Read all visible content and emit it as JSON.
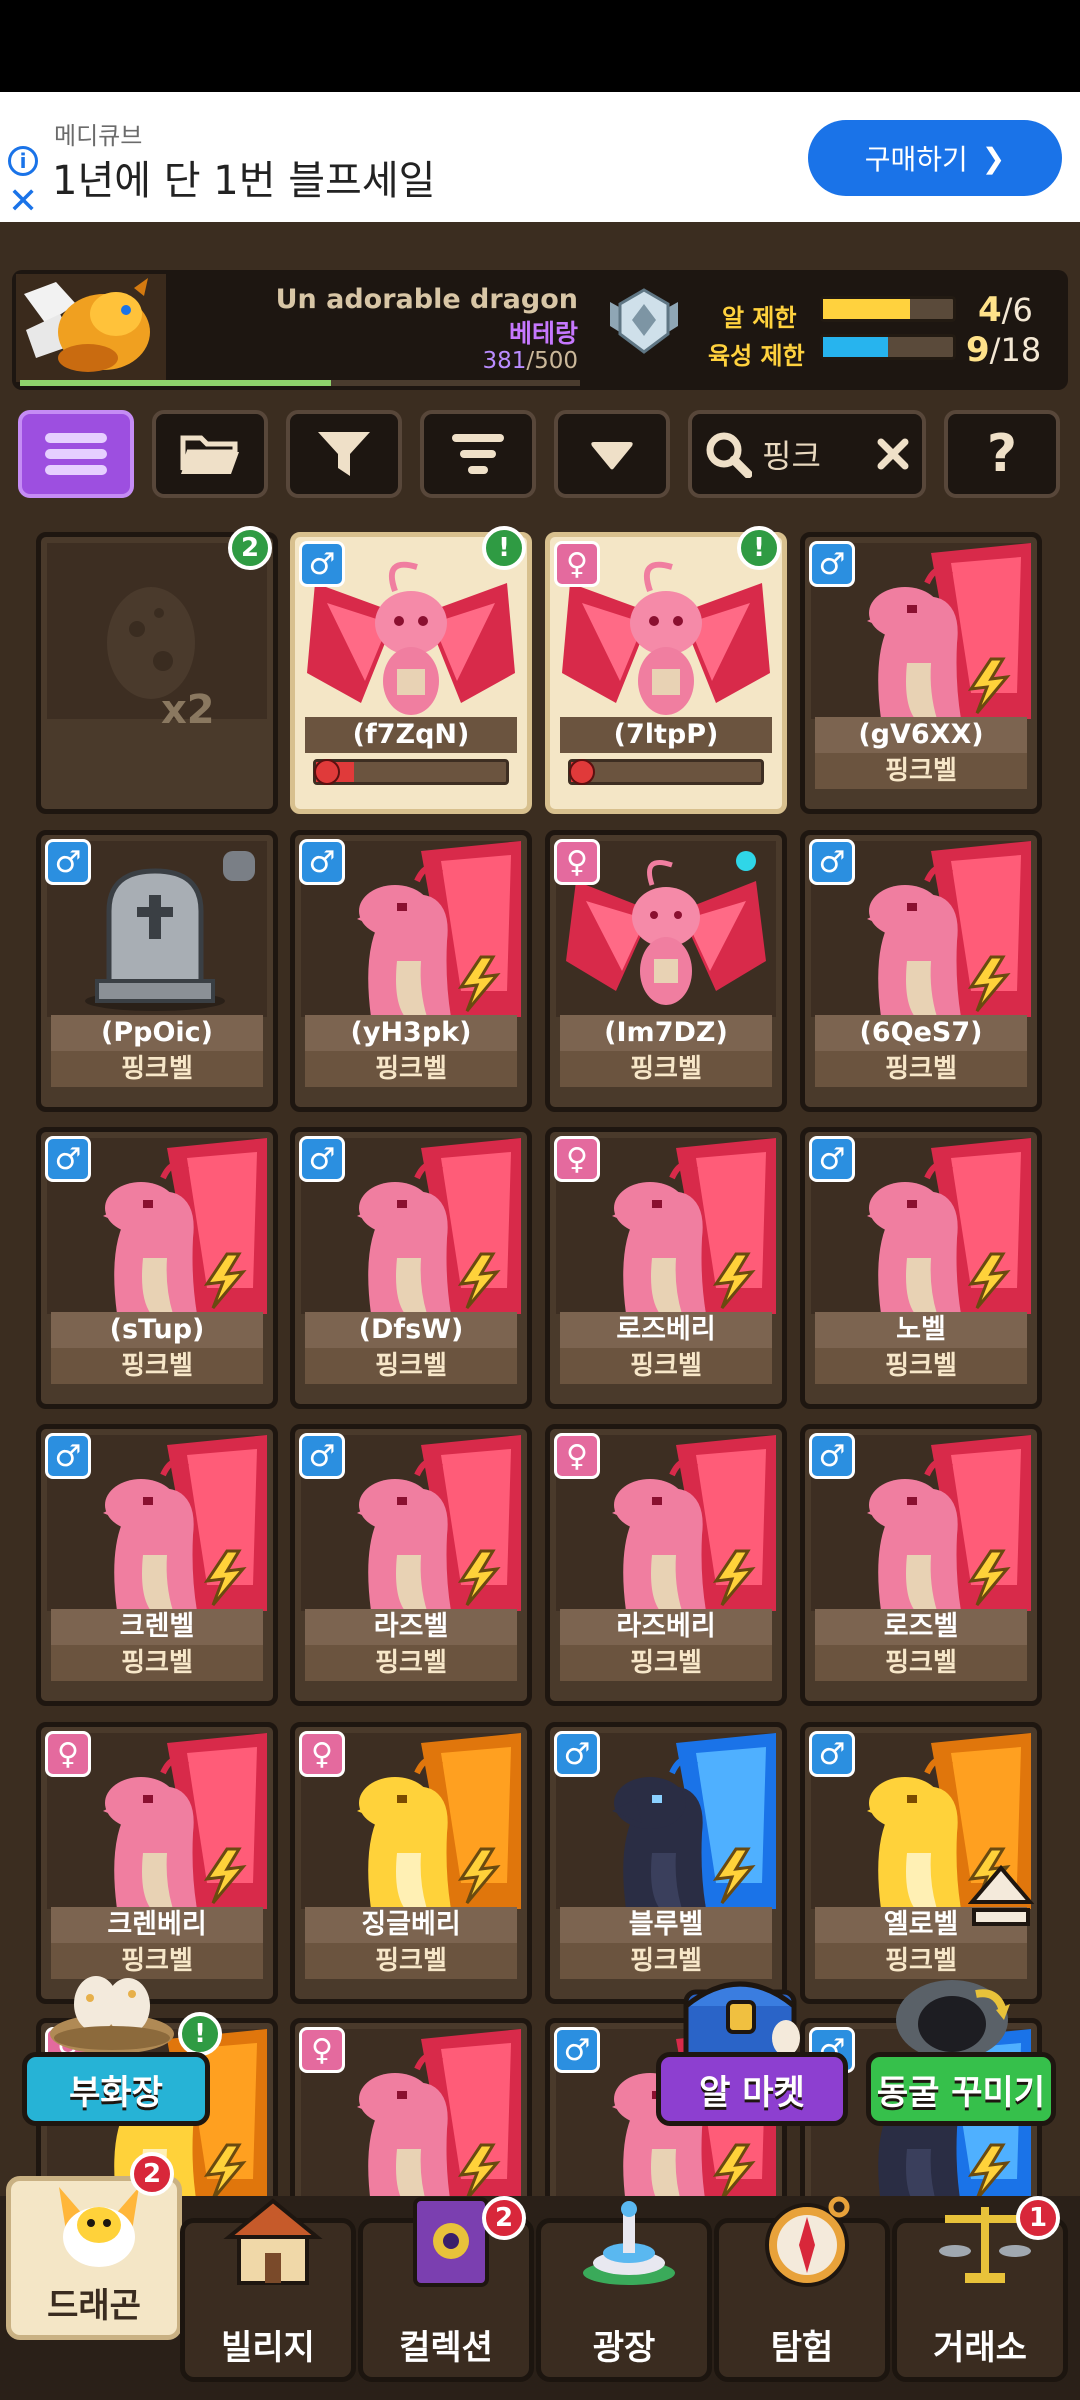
{
  "ad": {
    "sponsor": "메디큐브",
    "title": "1년에 단 1번 블프세일",
    "cta": "구매하기",
    "info_icon": "info-icon",
    "close_icon": "close-icon"
  },
  "header": {
    "dragon_title": "Un adorable dragon",
    "dragon_species": "베테랑",
    "xp_current": "381",
    "xp_total": "/500",
    "xp_fraction": 0.76,
    "egg_limit_label": "알 제한",
    "egg_limit_value": "4",
    "egg_limit_max": "/6",
    "egg_fraction": 0.67,
    "breed_limit_label": "육성 제한",
    "breed_limit_value": "9",
    "breed_limit_max": "/18",
    "breed_fraction": 0.5,
    "egg_color": "#ffd23e",
    "breed_color": "#27b4ee"
  },
  "toolbar": {
    "search_value": "핑크",
    "icons": [
      "menu-icon",
      "folder-icon",
      "filter-icon",
      "sort-icon",
      "dropdown-icon",
      "search-icon",
      "clear-icon",
      "help-icon"
    ]
  },
  "cards": [
    {
      "type": "egg",
      "count": "x2",
      "badge": "2"
    },
    {
      "type": "selected",
      "sex": "m",
      "name": "(f7ZqN)",
      "alert": "!",
      "health": 0.2
    },
    {
      "type": "selected",
      "sex": "f",
      "name": "(7ltpP)",
      "alert": "!",
      "health": 0.05
    },
    {
      "sex": "m",
      "name": "(gV6XX)",
      "species": "핑크벨",
      "art": "pink"
    },
    {
      "sex": "m",
      "name": "(PpOic)",
      "species": "핑크벨",
      "art": "grave"
    },
    {
      "sex": "m",
      "name": "(yH3pk)",
      "species": "핑크벨",
      "art": "pink"
    },
    {
      "sex": "f",
      "name": "(Im7DZ)",
      "species": "핑크벨",
      "art": "fairy"
    },
    {
      "sex": "m",
      "name": "(6QeS7)",
      "species": "핑크벨",
      "art": "pink"
    },
    {
      "sex": "m",
      "name": "(sTup)",
      "species": "핑크벨",
      "art": "pink"
    },
    {
      "sex": "m",
      "name": "(DfsW)",
      "species": "핑크벨",
      "art": "pink"
    },
    {
      "sex": "f",
      "name": "로즈베리",
      "species": "핑크벨",
      "art": "pink"
    },
    {
      "sex": "m",
      "name": "노벨",
      "species": "핑크벨",
      "art": "pink"
    },
    {
      "sex": "m",
      "name": "크렌벨",
      "species": "핑크벨",
      "art": "pink"
    },
    {
      "sex": "m",
      "name": "라즈벨",
      "species": "핑크벨",
      "art": "pink"
    },
    {
      "sex": "f",
      "name": "라즈베리",
      "species": "핑크벨",
      "art": "pink"
    },
    {
      "sex": "m",
      "name": "로즈벨",
      "species": "핑크벨",
      "art": "pink"
    },
    {
      "sex": "f",
      "name": "크렌베리",
      "species": "핑크벨",
      "art": "pink"
    },
    {
      "sex": "f",
      "name": "징글베리",
      "species": "핑크벨",
      "art": "yellow"
    },
    {
      "sex": "m",
      "name": "블루벨",
      "species": "핑크벨",
      "art": "blue"
    },
    {
      "sex": "m",
      "name": "옐로벨",
      "species": "핑크벨",
      "art": "yellow"
    }
  ],
  "partial_row": [
    {
      "sex": "f",
      "art": "yellow"
    },
    {
      "sex": "f",
      "art": "pink"
    },
    {
      "sex": "m",
      "art": "pink"
    },
    {
      "sex": "m",
      "art": "blue"
    }
  ],
  "floating": {
    "hatchery": "부화장",
    "hatchery_alert": "!",
    "egg_market": "알 마켓",
    "cave_decor": "동굴 꾸미기"
  },
  "nav": [
    {
      "label": "드래곤",
      "badge": "2",
      "icon": "dragon-icon",
      "active": true
    },
    {
      "label": "빌리지",
      "badge": "",
      "icon": "village-icon"
    },
    {
      "label": "컬렉션",
      "badge": "2",
      "icon": "book-icon"
    },
    {
      "label": "광장",
      "badge": "",
      "icon": "fountain-icon"
    },
    {
      "label": "탐험",
      "badge": "",
      "icon": "compass-icon"
    },
    {
      "label": "거래소",
      "badge": "1",
      "icon": "scale-icon"
    }
  ]
}
